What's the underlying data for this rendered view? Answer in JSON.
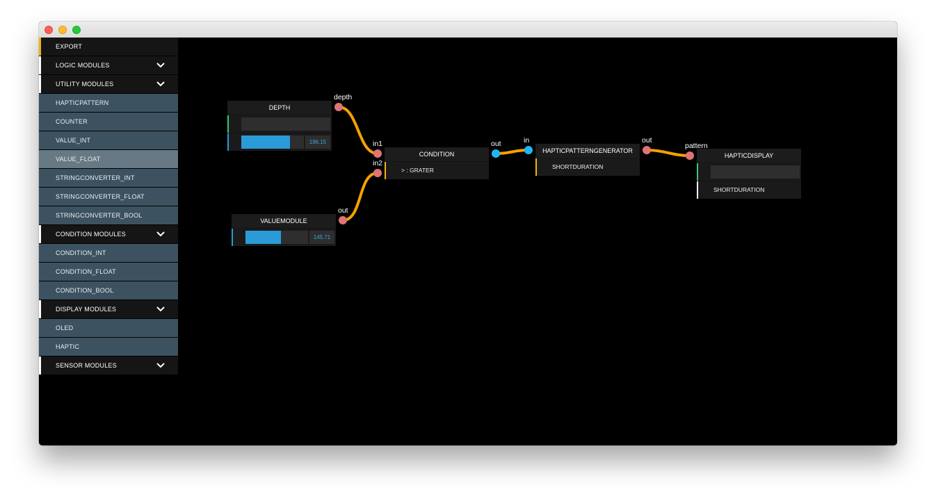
{
  "sidebar": {
    "items": [
      {
        "label": "EXPORT",
        "kind": "head",
        "accent": "#f2b614",
        "chevron": false
      },
      {
        "label": "LOGIC MODULES",
        "kind": "head",
        "accent": "#ffffff",
        "chevron": true
      },
      {
        "label": "UTILITY MODULES",
        "kind": "head",
        "accent": "#ffffff",
        "chevron": true
      },
      {
        "label": "HAPTICPATTERN",
        "kind": "sub"
      },
      {
        "label": "COUNTER",
        "kind": "sub"
      },
      {
        "label": "VALUE_INT",
        "kind": "sub"
      },
      {
        "label": "VALUE_FLOAT",
        "kind": "sub",
        "active": true
      },
      {
        "label": "STRINGCONVERTER_INT",
        "kind": "sub"
      },
      {
        "label": "STRINGCONVERTER_FLOAT",
        "kind": "sub"
      },
      {
        "label": "STRINGCONVERTER_BOOL",
        "kind": "sub"
      },
      {
        "label": "CONDITION MODULES",
        "kind": "head",
        "accent": "#ffffff",
        "chevron": true
      },
      {
        "label": "CONDITION_INT",
        "kind": "sub"
      },
      {
        "label": "CONDITION_FLOAT",
        "kind": "sub"
      },
      {
        "label": "CONDITION_BOOL",
        "kind": "sub"
      },
      {
        "label": "DISPLAY MODULES",
        "kind": "head",
        "accent": "#ffffff",
        "chevron": true
      },
      {
        "label": "OLED",
        "kind": "sub"
      },
      {
        "label": "HAPTIC",
        "kind": "sub"
      },
      {
        "label": "SENSOR MODULES",
        "kind": "head",
        "accent": "#ffffff",
        "chevron": true
      }
    ]
  },
  "modules": {
    "depth": {
      "title": "DEPTH",
      "value": "196.15",
      "fill_fraction": 0.78,
      "port_label": "depth"
    },
    "valuemodule": {
      "title": "VALUEMODULE",
      "value": "145.71",
      "fill_fraction": 0.57,
      "port_label": "out"
    },
    "condition": {
      "title": "CONDITION",
      "row": "> : GRATER",
      "in1_label": "in1",
      "in2_label": "in2",
      "out_label": "out"
    },
    "hapticpatterngenerator": {
      "title": "HAPTICPATTERNGENERATOR",
      "row": "SHORTDURATION",
      "in_label": "in",
      "out_label": "out"
    },
    "hapticdisplay": {
      "title": "HAPTICDISPLAY",
      "row": "SHORTDURATION",
      "port_label": "pattern"
    }
  },
  "colors": {
    "wire": "#f5a200",
    "port_red": "#e07474",
    "port_blue": "#1fb6f5",
    "accent_green": "#2ecf6a",
    "accent_blue": "#2b9bd8",
    "accent_yellow": "#f2b614",
    "accent_white": "#ffffff"
  }
}
